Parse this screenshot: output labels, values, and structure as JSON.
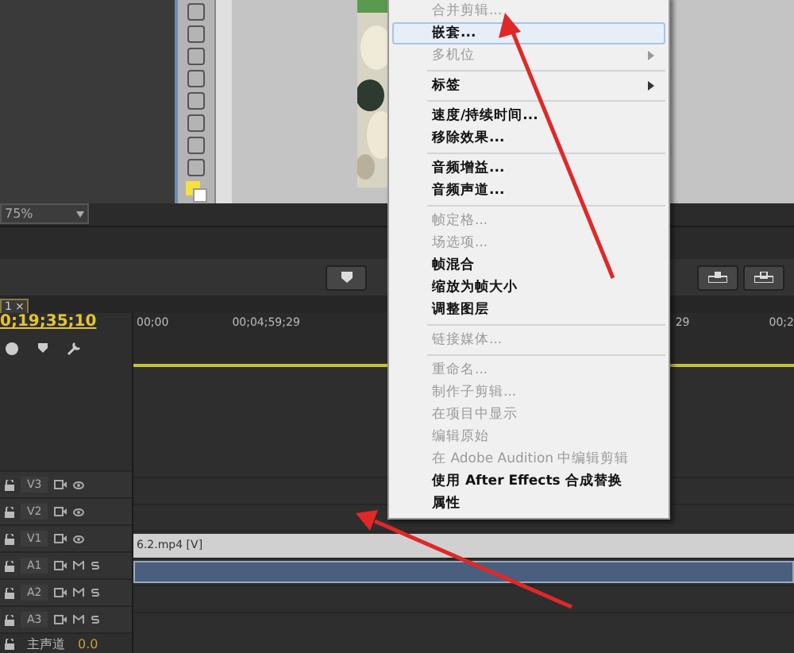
{
  "program_monitor": {
    "zoom": "75%"
  },
  "sequence_tab": {
    "label": "1",
    "close": "×"
  },
  "timeline": {
    "timecode": "0;19;35;10",
    "ruler": [
      {
        "label": "00;00"
      },
      {
        "label": "00;04;59;29"
      },
      {
        "label": "29"
      },
      {
        "label": "00;2"
      }
    ],
    "tracks": [
      {
        "name": "V3",
        "kind": "video"
      },
      {
        "name": "V2",
        "kind": "video"
      },
      {
        "name": "V1",
        "kind": "video",
        "clip": "6.2.mp4 [V]"
      },
      {
        "name": "A1",
        "kind": "audio",
        "clip": true
      },
      {
        "name": "A2",
        "kind": "audio"
      },
      {
        "name": "A3",
        "kind": "audio"
      }
    ],
    "master": {
      "name": "主声道",
      "value": "0.0"
    }
  },
  "context_menu": [
    {
      "kind": "item",
      "label": "合并剪辑...",
      "disabled": true,
      "selected": false,
      "submenu": false
    },
    {
      "kind": "item",
      "label": "嵌套...",
      "disabled": false,
      "selected": true,
      "submenu": false
    },
    {
      "kind": "item",
      "label": "多机位",
      "disabled": true,
      "selected": false,
      "submenu": true
    },
    {
      "kind": "separator"
    },
    {
      "kind": "item",
      "label": "标签",
      "disabled": false,
      "selected": false,
      "submenu": true
    },
    {
      "kind": "separator"
    },
    {
      "kind": "item",
      "label": "速度/持续时间...",
      "disabled": false,
      "selected": false,
      "submenu": false
    },
    {
      "kind": "item",
      "label": "移除效果...",
      "disabled": false,
      "selected": false,
      "submenu": false
    },
    {
      "kind": "separator"
    },
    {
      "kind": "item",
      "label": "音频增益...",
      "disabled": false,
      "selected": false,
      "submenu": false
    },
    {
      "kind": "item",
      "label": "音频声道...",
      "disabled": false,
      "selected": false,
      "submenu": false
    },
    {
      "kind": "separator"
    },
    {
      "kind": "item",
      "label": "帧定格...",
      "disabled": true,
      "selected": false,
      "submenu": false
    },
    {
      "kind": "item",
      "label": "场选项...",
      "disabled": true,
      "selected": false,
      "submenu": false
    },
    {
      "kind": "item",
      "label": "帧混合",
      "disabled": false,
      "selected": false,
      "submenu": false
    },
    {
      "kind": "item",
      "label": "缩放为帧大小",
      "disabled": false,
      "selected": false,
      "submenu": false
    },
    {
      "kind": "item",
      "label": "调整图层",
      "disabled": false,
      "selected": false,
      "submenu": false
    },
    {
      "kind": "separator"
    },
    {
      "kind": "item",
      "label": "链接媒体...",
      "disabled": true,
      "selected": false,
      "submenu": false
    },
    {
      "kind": "separator"
    },
    {
      "kind": "item",
      "label": "重命名...",
      "disabled": true,
      "selected": false,
      "submenu": false
    },
    {
      "kind": "item",
      "label": "制作子剪辑...",
      "disabled": true,
      "selected": false,
      "submenu": false
    },
    {
      "kind": "item",
      "label": "在项目中显示",
      "disabled": true,
      "selected": false,
      "submenu": false
    },
    {
      "kind": "item",
      "label": "编辑原始",
      "disabled": true,
      "selected": false,
      "submenu": false
    },
    {
      "kind": "item",
      "label": "在 Adobe Audition 中编辑剪辑",
      "disabled": true,
      "selected": false,
      "submenu": false
    },
    {
      "kind": "item",
      "label": "使用 After Effects 合成替换",
      "disabled": false,
      "selected": false,
      "submenu": false
    },
    {
      "kind": "item",
      "label": "属性",
      "disabled": false,
      "selected": false,
      "submenu": false
    }
  ]
}
